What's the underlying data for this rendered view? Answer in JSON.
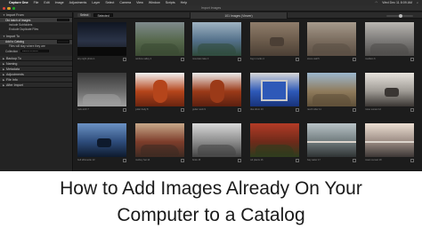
{
  "menubar": {
    "app": "Capture One",
    "items": [
      "File",
      "Edit",
      "Image",
      "Adjustments",
      "Layer",
      "Select",
      "Camera",
      "View",
      "Window",
      "Scripts",
      "Help"
    ],
    "clock": "Wed Dec 11 8:09 AM"
  },
  "window": {
    "title": "Import Images"
  },
  "sidebar": {
    "panels": [
      {
        "title": "Import From"
      },
      {
        "title": "Import To"
      },
      {
        "title": "Backup To"
      },
      {
        "title": "Naming"
      },
      {
        "title": "Metadata"
      },
      {
        "title": "Adjustments"
      },
      {
        "title": "File Info"
      },
      {
        "title": "After Import"
      }
    ],
    "import_from_rows": [
      {
        "label": "Old batch of images",
        "sel": true
      },
      {
        "label": "Include Subfolders",
        "sel": false
      },
      {
        "label": "Exclude Duplicate Files",
        "sel": false
      }
    ],
    "import_to_rows": [
      {
        "label": "Add to Catalog",
        "sel": true
      },
      {
        "label": "Files will stay where they are",
        "sel": false
      },
      {
        "label": "Collection",
        "sel": false
      }
    ],
    "collection_value": "Recent Imports"
  },
  "toolbar": {
    "view_button": "Select",
    "select_label": "Selected",
    "tab_label": "101 Images (Viewer)"
  },
  "thumbnails": [
    {
      "caption": "sky night photo 1",
      "colors": [
        "#0f1521",
        "#2a3347",
        "#151515"
      ],
      "subject": "night-sky"
    },
    {
      "caption": "rainbow valley 2",
      "colors": [
        "#7f8a8c",
        "#56684c",
        "#3b4a33"
      ],
      "subject": "rainbow"
    },
    {
      "caption": "mountain lake 3",
      "colors": [
        "#9fb3c2",
        "#53708a",
        "#2f4a3b"
      ],
      "subject": "lake"
    },
    {
      "caption": "dog in rocks 4",
      "colors": [
        "#8f7d6b",
        "#6b5b4b",
        "#4b3f35"
      ],
      "subject": "dog"
    },
    {
      "caption": "stone wall 5",
      "colors": [
        "#a69a8c",
        "#7a6c5e",
        "#5a4e43"
      ],
      "subject": "stone"
    },
    {
      "caption": "boulders 6",
      "colors": [
        "#b9b6b1",
        "#7c7a78",
        "#4e4c4a"
      ],
      "subject": "boulders"
    },
    {
      "caption": "rock arch 7",
      "colors": [
        "#3a3a3a",
        "#6b6b6b",
        "#a0a0a0"
      ],
      "subject": "rock"
    },
    {
      "caption": "guitar body 8",
      "colors": [
        "#f2f2f2",
        "#b5451b",
        "#6a2410"
      ],
      "subject": "guitar"
    },
    {
      "caption": "guitar neck 9",
      "colors": [
        "#ececec",
        "#9b3a18",
        "#5c2010"
      ],
      "subject": "guitar"
    },
    {
      "caption": "blue drum 10",
      "colors": [
        "#d8d8d8",
        "#2e59b8",
        "#18337a"
      ],
      "subject": "drum"
    },
    {
      "caption": "ranch rider 11",
      "colors": [
        "#9cb7cf",
        "#8f7b5c",
        "#5e4f38"
      ],
      "subject": "ranch"
    },
    {
      "caption": "horse sunset 12",
      "colors": [
        "#e7e3dd",
        "#9e9a94",
        "#3a3633"
      ],
      "subject": "horse"
    },
    {
      "caption": "bull silhouette 13",
      "colors": [
        "#6b92c4",
        "#2d4b7a",
        "#0e1a2d"
      ],
      "subject": "bull"
    },
    {
      "caption": "cowboy hat 14",
      "colors": [
        "#c8a98a",
        "#7d3d2b",
        "#3d2a22"
      ],
      "subject": "hat"
    },
    {
      "caption": "birds 15",
      "colors": [
        "#d9d9d9",
        "#8b8b8b",
        "#444444"
      ],
      "subject": "bird"
    },
    {
      "caption": "red plants 16",
      "colors": [
        "#b43b26",
        "#6e2a1a",
        "#2d3d1e"
      ],
      "subject": "plants"
    },
    {
      "caption": "bay water 17",
      "colors": [
        "#b9c3c7",
        "#6f7a7c",
        "#2f3334"
      ],
      "subject": "water"
    },
    {
      "caption": "ocean sunset 18",
      "colors": [
        "#eddfd3",
        "#9a8b83",
        "#3c3735"
      ],
      "subject": "ocean"
    }
  ],
  "caption": {
    "line1": "How to Add Images Already On Your",
    "line2": "Computer to a Catalog"
  }
}
